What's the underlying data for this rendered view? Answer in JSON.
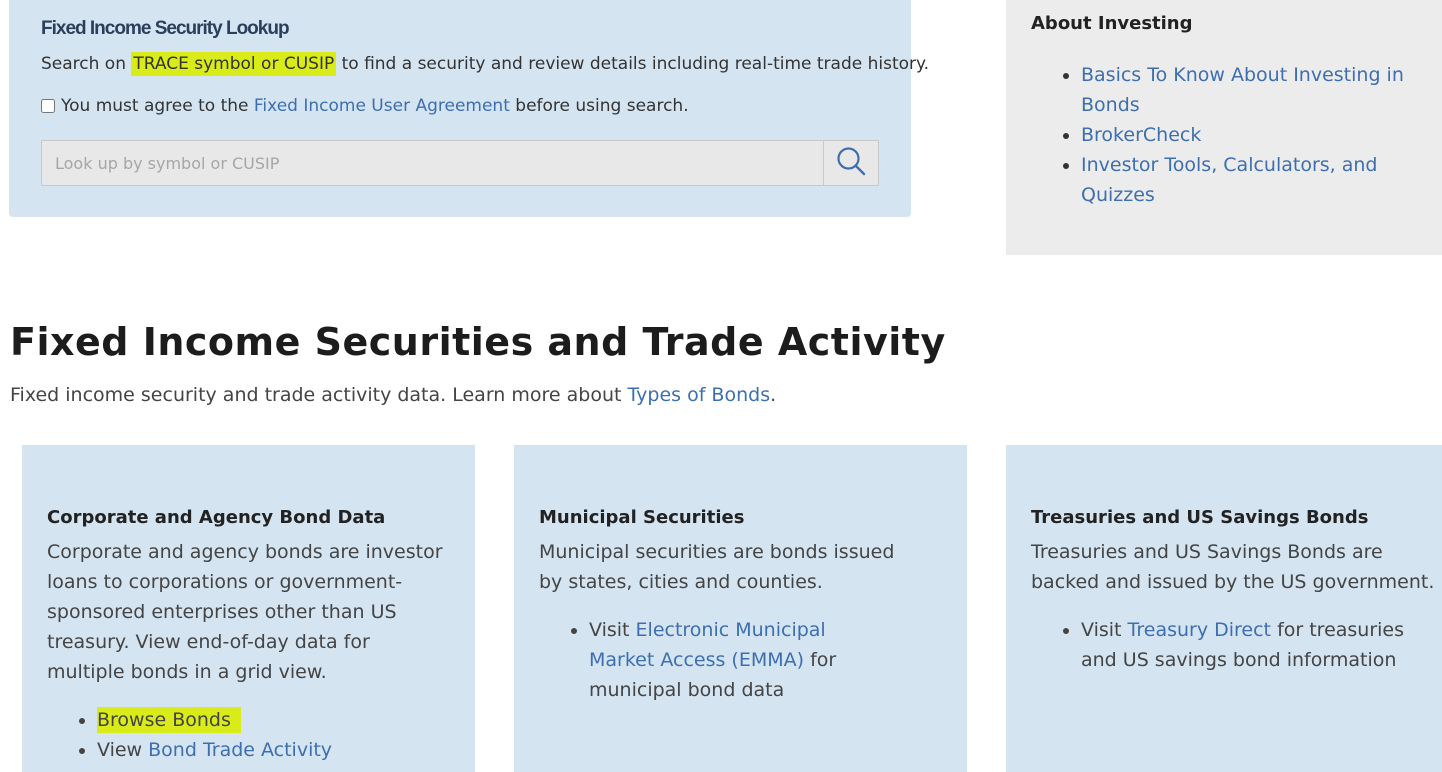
{
  "lookup": {
    "title": "Fixed Income Security Lookup",
    "desc_before": "Search on",
    "desc_highlight": "TRACE symbol or CUSIP",
    "desc_after": "to find a security and review details including real-time trade history.",
    "agree_before": "You must agree to the",
    "agree_link": "Fixed Income User Agreement",
    "agree_after": "before using search.",
    "search_placeholder": "Look up by symbol or CUSIP",
    "search_value": ""
  },
  "about": {
    "title": "About Investing",
    "links": [
      "Basics To Know About Investing in Bonds",
      "BrokerCheck",
      "Investor Tools, Calculators, and Quizzes"
    ]
  },
  "section": {
    "title": "Fixed Income Securities and Trade Activity",
    "desc_before": "Fixed income security and trade activity data. Learn more about",
    "desc_link": "Types of Bonds",
    "desc_after": "."
  },
  "cards": [
    {
      "title": "Corporate and Agency Bond Data",
      "text": "Corporate and agency bonds are investor loans to corporations or government-sponsored enterprises other than US treasury. View end-of-day data for multiple bonds in a grid view.",
      "item1_link": "Browse Bonds",
      "item2_before": "View",
      "item2_link": "Bond Trade Activity"
    },
    {
      "title": "Municipal Securities",
      "text": "Municipal securities are bonds issued by states, cities and counties.",
      "item_before": "Visit",
      "item_link": "Electronic Municipal Market Access (EMMA)",
      "item_after": "for municipal bond data"
    },
    {
      "title": "Treasuries and US Savings Bonds",
      "text": "Treasuries and US Savings Bonds are backed and issued by the US government.",
      "item_before": "Visit",
      "item_link": "Treasury Direct",
      "item_after": "for treasuries and US savings bond information"
    }
  ],
  "colors": {
    "panel_blue": "#d4e4f1",
    "about_gray": "#ececec",
    "link": "#3d6fb0",
    "highlight": "#d9ec1a"
  }
}
